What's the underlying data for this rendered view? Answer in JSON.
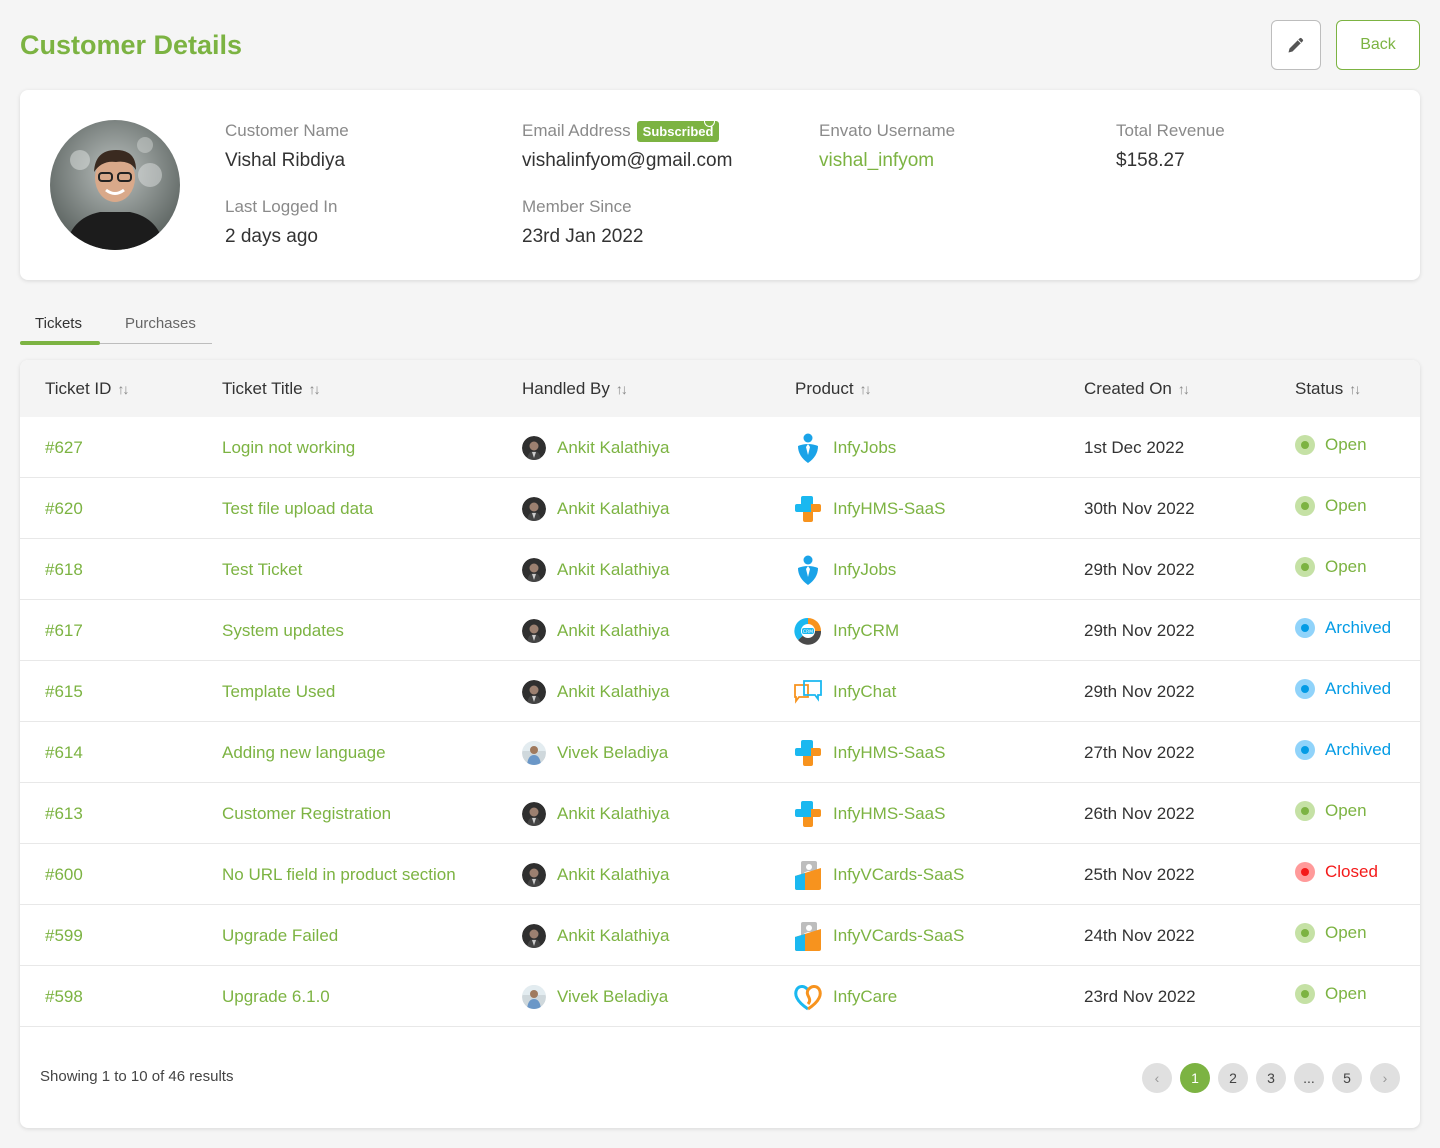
{
  "header": {
    "title": "Customer Details",
    "edit_icon": "pencil-icon",
    "back_label": "Back"
  },
  "profile": {
    "customer_name_label": "Customer Name",
    "customer_name": "Vishal Ribdiya",
    "email_label": "Email Address",
    "email_badge": "Subscribed",
    "email": "vishalinfyom@gmail.com",
    "envato_label": "Envato Username",
    "envato_username": "vishal_infyom",
    "revenue_label": "Total Revenue",
    "revenue": "$158.27",
    "last_logged_label": "Last Logged In",
    "last_logged": "2 days ago",
    "member_since_label": "Member Since",
    "member_since": "23rd Jan 2022"
  },
  "tabs": [
    {
      "label": "Tickets",
      "active": true
    },
    {
      "label": "Purchases",
      "active": false
    }
  ],
  "table": {
    "columns": [
      "Ticket ID",
      "Ticket Title",
      "Handled By",
      "Product",
      "Created On",
      "Status"
    ],
    "rows": [
      {
        "id": "#627",
        "title": "Login not working",
        "handler": "Ankit Kalathiya",
        "product": "InfyJobs",
        "created": "1st Dec 2022",
        "status": "Open"
      },
      {
        "id": "#620",
        "title": "Test file upload data",
        "handler": "Ankit Kalathiya",
        "product": "InfyHMS-SaaS",
        "created": "30th Nov 2022",
        "status": "Open"
      },
      {
        "id": "#618",
        "title": "Test Ticket",
        "handler": "Ankit Kalathiya",
        "product": "InfyJobs",
        "created": "29th Nov 2022",
        "status": "Open"
      },
      {
        "id": "#617",
        "title": "System updates",
        "handler": "Ankit Kalathiya",
        "product": "InfyCRM",
        "created": "29th Nov 2022",
        "status": "Archived"
      },
      {
        "id": "#615",
        "title": "Template Used",
        "handler": "Ankit Kalathiya",
        "product": "InfyChat",
        "created": "29th Nov 2022",
        "status": "Archived"
      },
      {
        "id": "#614",
        "title": "Adding new language",
        "handler": "Vivek Beladiya",
        "product": "InfyHMS-SaaS",
        "created": "27th Nov 2022",
        "status": "Archived"
      },
      {
        "id": "#613",
        "title": "Customer Registration",
        "handler": "Ankit Kalathiya",
        "product": "InfyHMS-SaaS",
        "created": "26th Nov 2022",
        "status": "Open"
      },
      {
        "id": "#600",
        "title": "No URL field in product section",
        "handler": "Ankit Kalathiya",
        "product": "InfyVCards-SaaS",
        "created": "25th Nov 2022",
        "status": "Closed"
      },
      {
        "id": "#599",
        "title": "Upgrade Failed",
        "handler": "Ankit Kalathiya",
        "product": "InfyVCards-SaaS",
        "created": "24th Nov 2022",
        "status": "Open"
      },
      {
        "id": "#598",
        "title": "Upgrade 6.1.0",
        "handler": "Vivek Beladiya",
        "product": "InfyCare",
        "created": "23rd Nov 2022",
        "status": "Open"
      }
    ]
  },
  "status_colors": {
    "Open": {
      "text": "#7cb342",
      "ring": "#c5e1a5"
    },
    "Archived": {
      "text": "#039be5",
      "ring": "#90d3fa"
    },
    "Closed": {
      "text": "#f41a1a",
      "ring": "#ff9a9a"
    }
  },
  "footer": {
    "showing": "Showing 1 to 10 of 46 results",
    "pages": [
      "‹",
      "1",
      "2",
      "3",
      "...",
      "5",
      "›"
    ],
    "current_page": "1"
  },
  "colors": {
    "accent": "#7cb342",
    "background": "#f5f5f5"
  }
}
